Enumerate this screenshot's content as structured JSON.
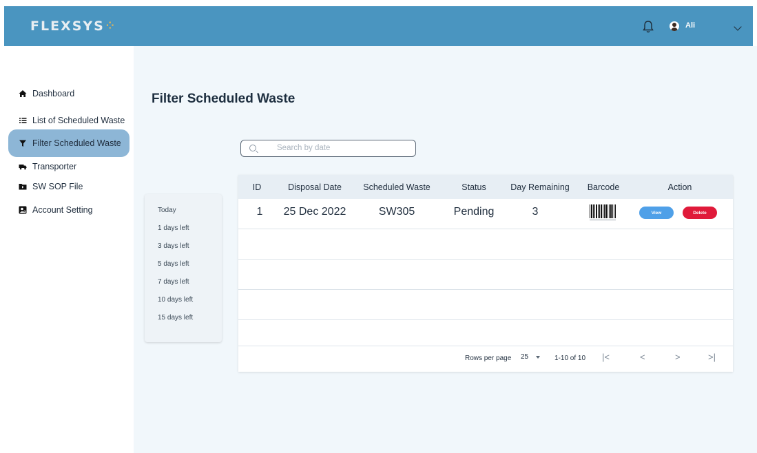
{
  "header": {
    "logo_text": "FLEXSYS",
    "logo_mark": "⁘",
    "username": "Ali"
  },
  "sidebar": {
    "items": [
      {
        "label": "Dashboard",
        "icon": "home-icon"
      },
      {
        "label": "List of Scheduled Waste",
        "icon": "list-icon"
      },
      {
        "label": "Filter Scheduled Waste",
        "icon": "filter-icon",
        "active": true
      },
      {
        "label": "Transporter",
        "icon": "truck-icon"
      },
      {
        "label": "SW SOP File",
        "icon": "folder-icon"
      },
      {
        "label": "Account Setting",
        "icon": "account-settings-icon"
      }
    ]
  },
  "main": {
    "title": "Filter Scheduled Waste",
    "search": {
      "placeholder": "Search by date"
    },
    "filters": [
      "Today",
      "1 days left",
      "3 days left",
      "5 days left",
      "7 days left",
      "10 days left",
      "15 days left"
    ],
    "table": {
      "columns": [
        "ID",
        "Disposal Date",
        "Scheduled Waste",
        "Status",
        "Day Remaining",
        "Barcode",
        "Action"
      ],
      "rows": [
        {
          "id": "1",
          "disposal_date": "25 Dec 2022",
          "scheduled_waste": "SW305",
          "status": "Pending",
          "day_remaining": "3",
          "view_label": "View",
          "delete_label": "Delete"
        }
      ]
    },
    "pagination": {
      "rows_per_page_label": "Rows per page",
      "rows_per_page": "25",
      "range": "1-10 of 10",
      "first": "|<",
      "prev": "<",
      "next": ">",
      "last": ">|"
    }
  },
  "colors": {
    "topbar": "#4a95c0",
    "active_nav": "#8db6d6",
    "view_button": "#4fa0e8",
    "delete_button": "#e01a3a",
    "main_bg": "#f1f7fb"
  }
}
